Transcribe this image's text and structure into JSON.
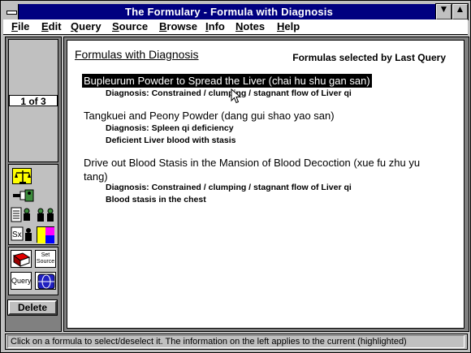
{
  "window": {
    "title": "The Formulary - Formula with Diagnosis"
  },
  "menu": [
    "File",
    "Edit",
    "Query",
    "Source",
    "Browse",
    "Info",
    "Notes",
    "Help"
  ],
  "sidebar": {
    "record_counter": "1 of 3",
    "tools_row_icons": [
      "scales-icon",
      "pointing-hand-icon",
      "document-people-icon",
      "people-icon",
      "sx-person-icon",
      "color-blocks-icon"
    ],
    "set_source_label": "Set Source",
    "query_label": "Query",
    "delete_label": "Delete"
  },
  "main": {
    "heading": "Formulas with Diagnosis",
    "selected_by": "Formulas selected by Last Query",
    "formulas": [
      {
        "name": "Bupleurum Powder to Spread the Liver (chai hu shu gan san)",
        "selected": true,
        "diagnosis_lines": [
          "Diagnosis:  Constrained / clumping / stagnant flow of Liver qi"
        ]
      },
      {
        "name": "Tangkuei and Peony Powder (dang gui shao yao san)",
        "selected": false,
        "diagnosis_lines": [
          "Diagnosis:  Spleen qi deficiency",
          "Deficient Liver blood with stasis"
        ]
      },
      {
        "name_lines": [
          "Drive out Blood Stasis in the Mansion of Blood Decoction (xue fu zhu yu",
          "tang)"
        ],
        "selected": false,
        "diagnosis_lines": [
          "Diagnosis:  Constrained / clumping / stagnant flow of Liver qi",
          "Blood stasis in the chest"
        ]
      }
    ]
  },
  "status": {
    "message": "Click on a formula to select/deselect it. The information on the left applies to the current (highlighted)"
  },
  "colors": {
    "titlebar": "#000080",
    "face": "#c0c0c0",
    "highlight": "#000000"
  }
}
